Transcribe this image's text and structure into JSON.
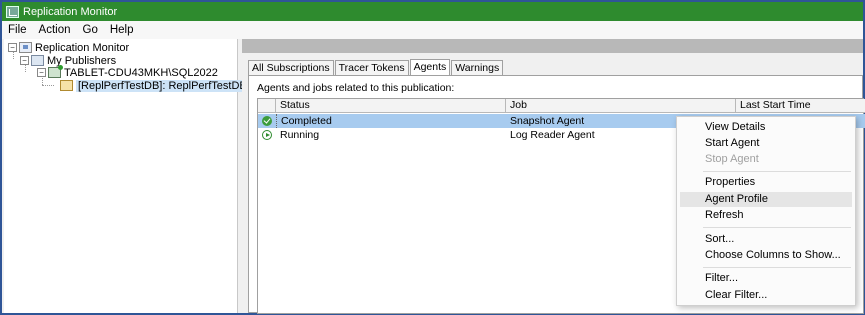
{
  "window": {
    "title": "Replication Monitor"
  },
  "menubar": {
    "items": [
      "File",
      "Action",
      "Go",
      "Help"
    ]
  },
  "tree": {
    "root": "Replication Monitor",
    "publishers": "My Publishers",
    "server": "TABLET-CDU43MKH\\SQL2022",
    "publication": "[ReplPerfTestDB]: ReplPerfTestDB_PUB"
  },
  "tabs": [
    "All Subscriptions",
    "Tracer Tokens",
    "Agents",
    "Warnings"
  ],
  "active_tab": "Agents",
  "caption": "Agents and jobs related to this publication:",
  "grid": {
    "columns": [
      "Status",
      "Job",
      "Last Start Time"
    ],
    "rows": [
      {
        "status": "Completed",
        "job": "Snapshot Agent",
        "status_icon": "check-icon"
      },
      {
        "status": "Running",
        "job": "Log Reader Agent",
        "status_icon": "play-icon"
      }
    ]
  },
  "context_menu": {
    "items": [
      {
        "label": "View Details",
        "disabled": false
      },
      {
        "label": "Start Agent",
        "disabled": false
      },
      {
        "label": "Stop Agent",
        "disabled": true
      },
      {
        "label": "Properties",
        "disabled": false
      },
      {
        "label": "Agent Profile",
        "disabled": false,
        "hovered": true
      },
      {
        "label": "Refresh",
        "disabled": false
      },
      {
        "label": "Sort...",
        "disabled": false
      },
      {
        "label": "Choose Columns to Show...",
        "disabled": false
      },
      {
        "label": "Filter...",
        "disabled": false
      },
      {
        "label": "Clear Filter...",
        "disabled": false
      }
    ]
  },
  "colors": {
    "titlebar": "#2e8b2e",
    "selection": "#a7cbef",
    "frame": "#2f5597"
  }
}
